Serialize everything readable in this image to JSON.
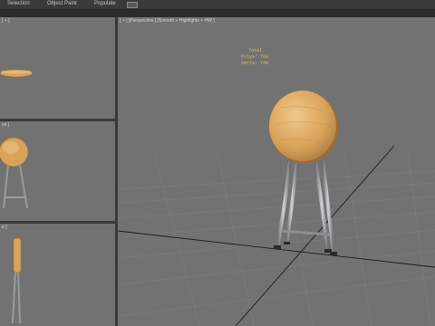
{
  "ribbon": {
    "tabs": [
      "Selection",
      "Object Paint",
      "Populate"
    ],
    "chip_symbol": "▪▾"
  },
  "viewports": {
    "top": {
      "label": "[ + ]"
    },
    "front": {
      "label": "ve ]"
    },
    "left": {
      "label": "e ]"
    },
    "perspective": {
      "label": "[ + ] [Perspective ] [Smooth + Highlights + HW ]",
      "stats": {
        "title": "Total",
        "polys_label": "Polys:",
        "polys_value": "760",
        "verts_label": "Verts:",
        "verts_value": "740"
      }
    }
  },
  "colors": {
    "viewport_bg": "#727272",
    "seat_wood": "#d8a35a",
    "legs": "#a9a9ad",
    "stats_text": "#e3c34f"
  }
}
